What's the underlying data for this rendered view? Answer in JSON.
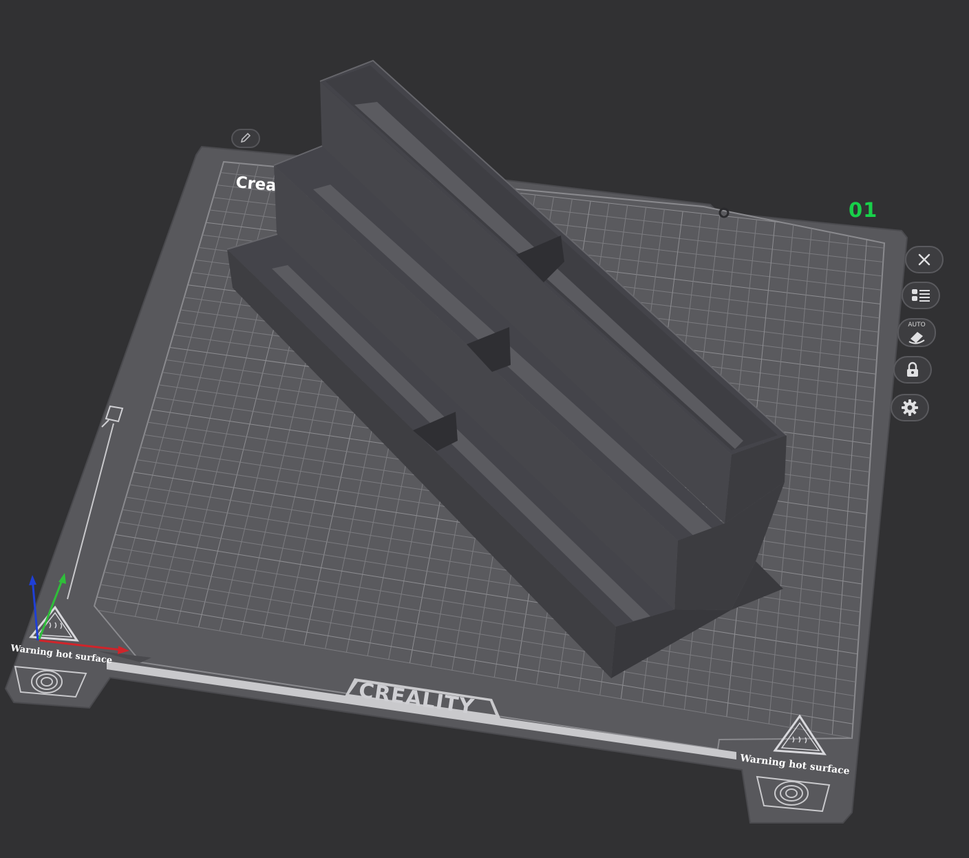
{
  "plate": {
    "brand_text": "Crea",
    "plate_number": "01",
    "logo_text": "CREALITY",
    "warning_left": "Warning hot surface",
    "warning_right": "Warning hot surface"
  },
  "toolbar": {
    "buttons": [
      {
        "name": "close-plate-button",
        "icon": "close-icon"
      },
      {
        "name": "arrange-button",
        "icon": "list-icon"
      },
      {
        "name": "auto-orient-button",
        "icon": "auto-orient-icon",
        "label": "AUTO"
      },
      {
        "name": "lock-plate-button",
        "icon": "lock-icon"
      },
      {
        "name": "plate-settings-button",
        "icon": "gear-icon"
      }
    ]
  },
  "axes": {
    "x_color": "#d0242a",
    "y_color": "#2fbf3a",
    "z_color": "#1f3fd6"
  },
  "colors": {
    "background": "#313133",
    "bed": "#58585c",
    "model": "#45454a",
    "accent_green": "#18d04a"
  }
}
